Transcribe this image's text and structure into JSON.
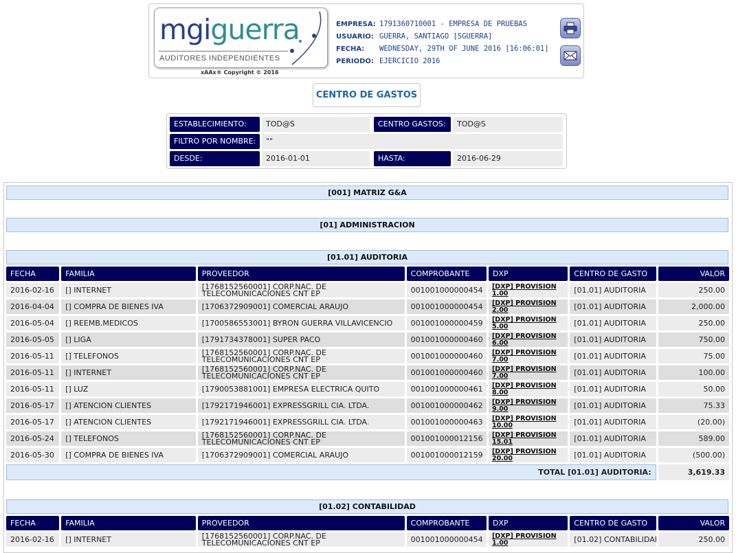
{
  "header": {
    "logo": {
      "brand_main": "mgi",
      "brand_secondary": "guerra",
      "subtitle": "AUDITORES INDEPENDIENTES"
    },
    "copyright": "xAAx® Copyright © 2016",
    "info": [
      {
        "key": "EMPRESA:",
        "value": "1791360710001 - EMPRESA DE PRUEBAS"
      },
      {
        "key": "USUARIO:",
        "value": "GUERRA, SANTIAGO [SGUERRA]"
      },
      {
        "key": "FECHA:",
        "value": "WEDNESDAY, 29TH OF JUNE 2016 [16:06:01]"
      },
      {
        "key": "PERIODO:",
        "value": "EJERCICIO 2016"
      }
    ],
    "print_icon": "printer-icon",
    "mail_icon": "mail-icon"
  },
  "page_title": "CENTRO DE GASTOS",
  "filters": {
    "establecimiento_label": "ESTABLECIMIENTO:",
    "establecimiento_value": "TOD@S",
    "centro_label": "CENTRO GASTOS:",
    "centro_value": "TOD@S",
    "filtro_label": "FILTRO POR NOMBRE:",
    "filtro_value": "\"\"",
    "desde_label": "DESDE:",
    "desde_value": "2016-01-01",
    "hasta_label": "HASTA:",
    "hasta_value": "2016-06-29"
  },
  "report": {
    "establecimiento": "[001] MATRIZ G&A",
    "departamento": "[01] ADMINISTRACION",
    "columns": [
      "FECHA",
      "FAMILIA",
      "PROVEEDOR",
      "COMPROBANTE",
      "DXP",
      "CENTRO DE GASTO",
      "VALOR"
    ],
    "sections": [
      {
        "title": "[01.01] AUDITORIA",
        "rows": [
          [
            "2016-02-16",
            "[] INTERNET",
            "[1768152560001] CORP.NAC. DE TELECOMUNICACIONES CNT EP",
            "001001000000454",
            "[DXP] PROVISION 1.00",
            "[01.01] AUDITORIA",
            "250.00"
          ],
          [
            "2016-04-04",
            "[] COMPRA DE BIENES IVA",
            "[1706372909001] COMERCIAL ARAUJO",
            "001001000000454",
            "[DXP] PROVISION 2.00",
            "[01.01] AUDITORIA",
            "2,000.00"
          ],
          [
            "2016-05-04",
            "[] REEMB.MEDICOS",
            "[1700586553001] BYRON GUERRA VILLAVICENCIO",
            "001001000000459",
            "[DXP] PROVISION 5.00",
            "[01.01] AUDITORIA",
            "250.00"
          ],
          [
            "2016-05-05",
            "[] LIGA",
            "[1791734378001] SUPER PACO",
            "001001000000460",
            "[DXP] PROVISION 6.00",
            "[01.01] AUDITORIA",
            "750.00"
          ],
          [
            "2016-05-11",
            "[] TELEFONOS",
            "[1768152560001] CORP.NAC. DE TELECOMUNICACIONES CNT EP",
            "001001000000460",
            "[DXP] PROVISION 7.00",
            "[01.01] AUDITORIA",
            "75.00"
          ],
          [
            "2016-05-11",
            "[] INTERNET",
            "[1768152560001] CORP.NAC. DE TELECOMUNICACIONES CNT EP",
            "001001000000460",
            "[DXP] PROVISION 7.00",
            "[01.01] AUDITORIA",
            "100.00"
          ],
          [
            "2016-05-11",
            "[] LUZ",
            "[1790053881001] EMPRESA ELECTRICA QUITO",
            "001001000000461",
            "[DXP] PROVISION 8.00",
            "[01.01] AUDITORIA",
            "50.00"
          ],
          [
            "2016-05-17",
            "[] ATENCION CLIENTES",
            "[1792171946001] EXPRESSGRILL CIA. LTDA.",
            "001001000000462",
            "[DXP] PROVISION 9.00",
            "[01.01] AUDITORIA",
            "75.33"
          ],
          [
            "2016-05-17",
            "[] ATENCION CLIENTES",
            "[1792171946001] EXPRESSGRILL CIA. LTDA.",
            "001001000000463",
            "[DXP] PROVISION 10.00",
            "[01.01] AUDITORIA",
            "(20.00)"
          ],
          [
            "2016-05-24",
            "[] TELEFONOS",
            "[1768152560001] CORP.NAC. DE TELECOMUNICACIONES CNT EP",
            "001001000012156",
            "[DXP] PROVISION 15.01",
            "[01.01] AUDITORIA",
            "589.00"
          ],
          [
            "2016-05-30",
            "[] COMPRA DE BIENES IVA",
            "[1706372909001] COMERCIAL ARAUJO",
            "001001000012159",
            "[DXP] PROVISION 20.00",
            "[01.01] AUDITORIA",
            "(500.00)"
          ]
        ],
        "total_label": "TOTAL [01.01] AUDITORIA:",
        "total_value": "3,619.33"
      },
      {
        "title": "[01.02] CONTABILIDAD",
        "rows": [
          [
            "2016-02-16",
            "[] INTERNET",
            "[1768152560001] CORP.NAC. DE TELECOMUNICACIONES CNT EP",
            "001001000000454",
            "[DXP] PROVISION 1.00",
            "[01.02] CONTABILIDAD",
            "250.00"
          ]
        ]
      }
    ]
  }
}
